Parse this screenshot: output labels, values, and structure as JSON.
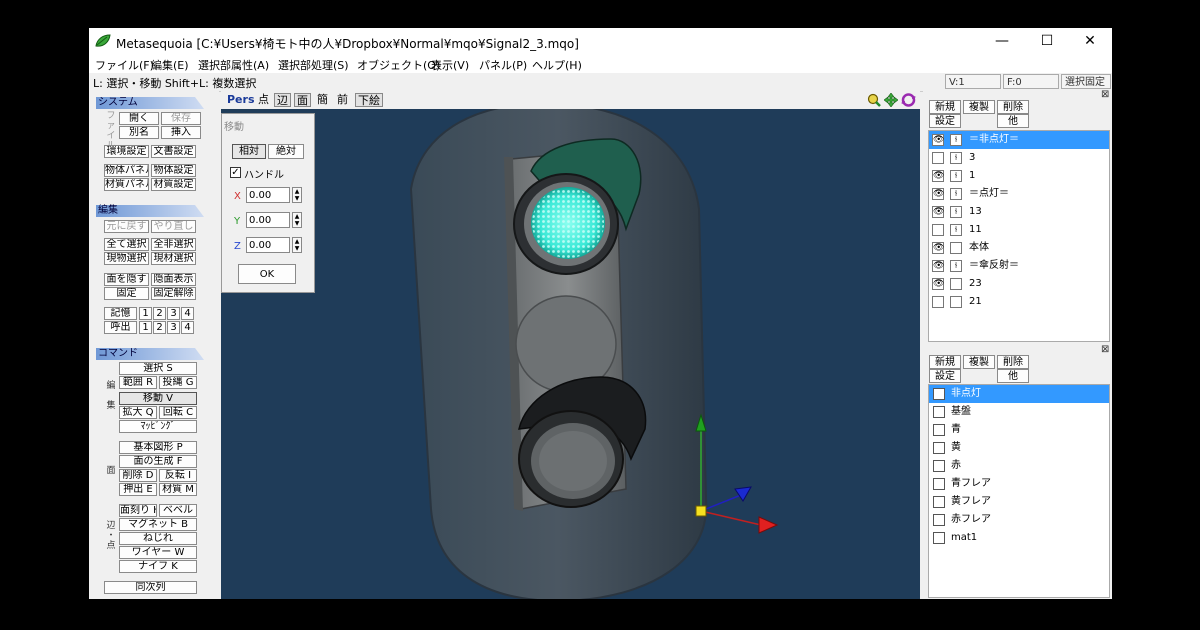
{
  "window": {
    "title": "Metasequoia [C:¥Users¥椅モト中の人¥Dropbox¥Normal¥mqo¥Signal2_3.mqo]",
    "minimize": "—",
    "maximize": "☐",
    "close": "✕"
  },
  "menu": [
    "ファイル(F)",
    "編集(E)",
    "選択部属性(A)",
    "選択部処理(S)",
    "オブジェクト(O)",
    "表示(V)",
    "パネル(P)",
    "ヘルプ(H)"
  ],
  "status": {
    "hint": "L: 選択・移動  Shift+L: 複数選択",
    "vertices": "V:1",
    "faces": "F:0",
    "lock": "選択固定"
  },
  "system": {
    "header": "システム",
    "file_label": "ファイル",
    "open": "開く",
    "save": "保存",
    "save_as": "別名",
    "insert": "挿入",
    "env": "環境設定",
    "doc": "文書設定",
    "obj_panel": "物体パネル",
    "obj_settings": "物体設定",
    "mat_panel": "材質パネル",
    "mat_settings": "材質設定"
  },
  "edit": {
    "header": "編集",
    "undo": "元に戻す",
    "redo": "やり直し",
    "select_all": "全て選択",
    "deselect_all": "全非選択",
    "cur_obj_select": "現物選択",
    "cur_mat_select": "現材選択",
    "hide_face": "面を隠す",
    "show_hidden": "隠面表示",
    "fix": "固定",
    "unfix": "固定解除",
    "memory": "記憶",
    "recall": "呼出",
    "nums": [
      "1",
      "2",
      "3",
      "4"
    ]
  },
  "command": {
    "header": "コマンド",
    "edit_label": "編集",
    "face_label": "面",
    "edge_label": "辺・点",
    "select": "選択 S",
    "range": "範囲 R",
    "lasso": "投縄 G",
    "move": "移動 V",
    "scale": "拡大 Q",
    "rotate": "回転 C",
    "mapping": "ﾏｯﾋﾟﾝｸﾞ",
    "primitive": "基本図形 P",
    "face_gen": "面の生成 F",
    "delete": "削除 D",
    "flip": "反転 I",
    "extrude": "押出 E",
    "material": "材質 M",
    "knife_cut": "面刻り H",
    "bevel": "ベベル",
    "magnet": "マグネット B",
    "twist": "ねじれ",
    "wire": "ワイヤー W",
    "knife": "ナイフ K",
    "simultaneous": "同次列"
  },
  "viewport": {
    "toolbar": [
      "Pers",
      "点",
      "辺",
      "面",
      "簡",
      "前",
      "下絵"
    ],
    "move_dialog": {
      "title": "移動",
      "relative": "相対",
      "absolute": "絶対",
      "handle_checked": true,
      "handle_label": "ハンドル",
      "axes": [
        {
          "label": "X",
          "value": "0.00",
          "color": "#d03030"
        },
        {
          "label": "Y",
          "value": "0.00",
          "color": "#2a9a2a"
        },
        {
          "label": "Z",
          "value": "0.00",
          "color": "#2a4ad0"
        }
      ],
      "ok": "OK"
    },
    "background_color": "#1f3c59"
  },
  "objects_panel": {
    "new": "新規",
    "copy": "複製",
    "delete": "削除",
    "settings": "設定",
    "other": "他",
    "items": [
      {
        "name": "＝非点灯＝",
        "visible": true,
        "locked": true,
        "selected": true
      },
      {
        "name": "3",
        "visible": false,
        "locked": true,
        "selected": false
      },
      {
        "name": "1",
        "visible": true,
        "locked": true,
        "selected": false
      },
      {
        "name": "＝点灯＝",
        "visible": true,
        "locked": true,
        "selected": false
      },
      {
        "name": "13",
        "visible": true,
        "locked": true,
        "selected": false
      },
      {
        "name": "11",
        "visible": false,
        "locked": true,
        "selected": false
      },
      {
        "name": "本体",
        "visible": true,
        "locked": false,
        "selected": false
      },
      {
        "name": "＝傘反射＝",
        "visible": true,
        "locked": true,
        "selected": false
      },
      {
        "name": "23",
        "visible": true,
        "locked": false,
        "selected": false
      },
      {
        "name": "21",
        "visible": false,
        "locked": false,
        "selected": false
      }
    ]
  },
  "materials_panel": {
    "new": "新規",
    "copy": "複製",
    "delete": "削除",
    "settings": "設定",
    "other": "他",
    "items": [
      {
        "name": "非点灯",
        "selected": true
      },
      {
        "name": "基盤",
        "selected": false
      },
      {
        "name": "青",
        "selected": false
      },
      {
        "name": "黄",
        "selected": false
      },
      {
        "name": "赤",
        "selected": false
      },
      {
        "name": "青フレア",
        "selected": false
      },
      {
        "name": "黄フレア",
        "selected": false
      },
      {
        "name": "赤フレア",
        "selected": false
      },
      {
        "name": "mat1",
        "selected": false
      }
    ]
  },
  "icons": {
    "eye": "eye-icon",
    "lock": "lock-icon",
    "zoom": "zoom-icon",
    "pan": "pan-icon",
    "rotate_view": "rotate-view-icon",
    "app": "metasequoia-leaf-icon"
  }
}
